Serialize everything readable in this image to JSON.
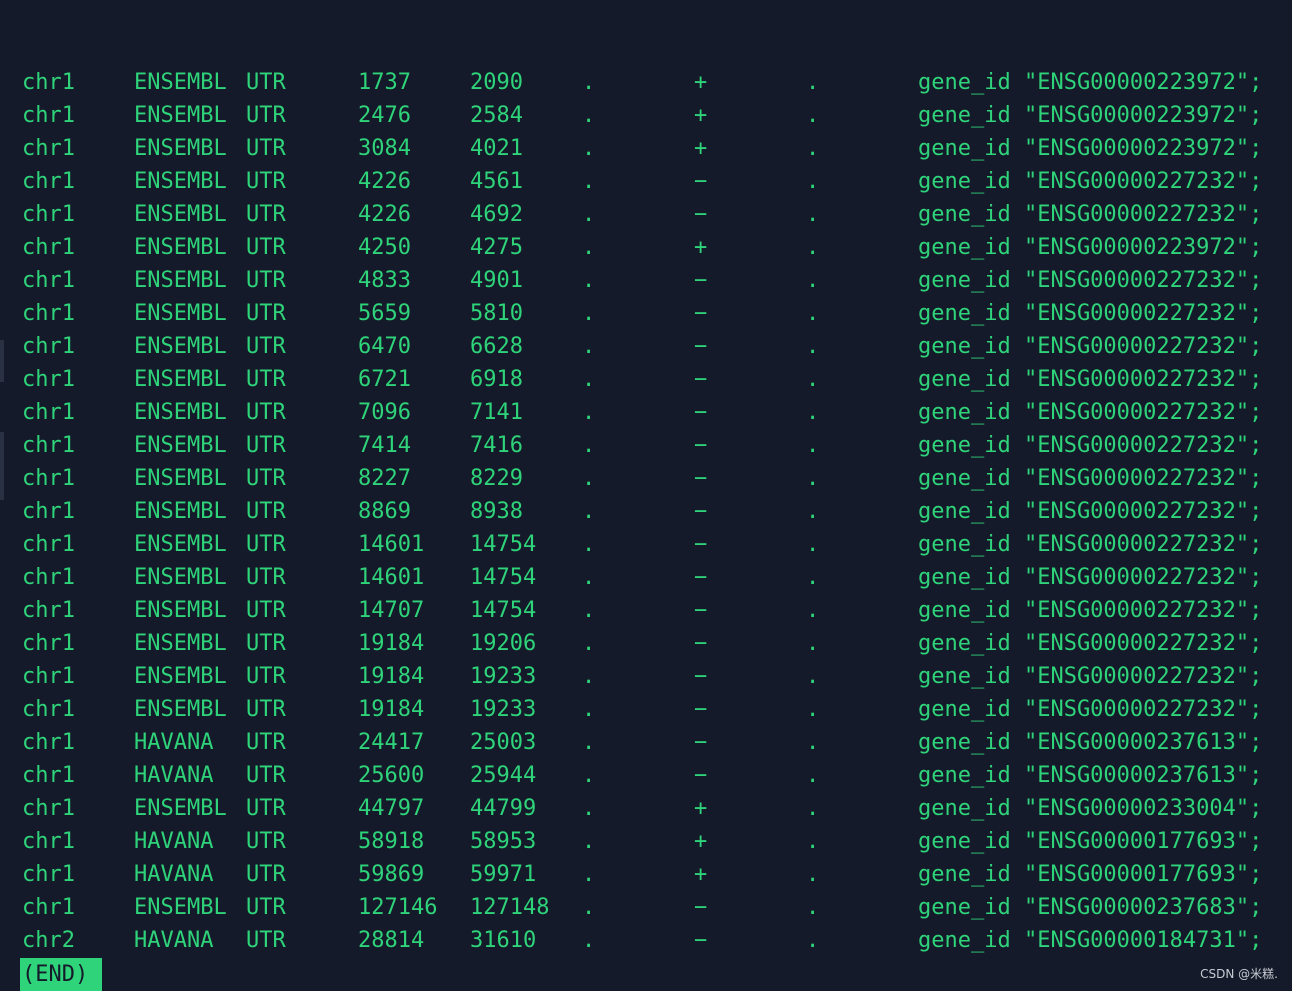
{
  "rows": [
    {
      "seq": "chr1",
      "source": "ENSEMBL",
      "feature": "UTR",
      "start": "1737",
      "end": "2090",
      "score": ".",
      "strand": "+",
      "frame": ".",
      "attr": "gene_id \"ENSG00000223972\";"
    },
    {
      "seq": "chr1",
      "source": "ENSEMBL",
      "feature": "UTR",
      "start": "2476",
      "end": "2584",
      "score": ".",
      "strand": "+",
      "frame": ".",
      "attr": "gene_id \"ENSG00000223972\";"
    },
    {
      "seq": "chr1",
      "source": "ENSEMBL",
      "feature": "UTR",
      "start": "3084",
      "end": "4021",
      "score": ".",
      "strand": "+",
      "frame": ".",
      "attr": "gene_id \"ENSG00000223972\";"
    },
    {
      "seq": "chr1",
      "source": "ENSEMBL",
      "feature": "UTR",
      "start": "4226",
      "end": "4561",
      "score": ".",
      "strand": "−",
      "frame": ".",
      "attr": "gene_id \"ENSG00000227232\";"
    },
    {
      "seq": "chr1",
      "source": "ENSEMBL",
      "feature": "UTR",
      "start": "4226",
      "end": "4692",
      "score": ".",
      "strand": "−",
      "frame": ".",
      "attr": "gene_id \"ENSG00000227232\";"
    },
    {
      "seq": "chr1",
      "source": "ENSEMBL",
      "feature": "UTR",
      "start": "4250",
      "end": "4275",
      "score": ".",
      "strand": "+",
      "frame": ".",
      "attr": "gene_id \"ENSG00000223972\";"
    },
    {
      "seq": "chr1",
      "source": "ENSEMBL",
      "feature": "UTR",
      "start": "4833",
      "end": "4901",
      "score": ".",
      "strand": "−",
      "frame": ".",
      "attr": "gene_id \"ENSG00000227232\";"
    },
    {
      "seq": "chr1",
      "source": "ENSEMBL",
      "feature": "UTR",
      "start": "5659",
      "end": "5810",
      "score": ".",
      "strand": "−",
      "frame": ".",
      "attr": "gene_id \"ENSG00000227232\";"
    },
    {
      "seq": "chr1",
      "source": "ENSEMBL",
      "feature": "UTR",
      "start": "6470",
      "end": "6628",
      "score": ".",
      "strand": "−",
      "frame": ".",
      "attr": "gene_id \"ENSG00000227232\";"
    },
    {
      "seq": "chr1",
      "source": "ENSEMBL",
      "feature": "UTR",
      "start": "6721",
      "end": "6918",
      "score": ".",
      "strand": "−",
      "frame": ".",
      "attr": "gene_id \"ENSG00000227232\";"
    },
    {
      "seq": "chr1",
      "source": "ENSEMBL",
      "feature": "UTR",
      "start": "7096",
      "end": "7141",
      "score": ".",
      "strand": "−",
      "frame": ".",
      "attr": "gene_id \"ENSG00000227232\";"
    },
    {
      "seq": "chr1",
      "source": "ENSEMBL",
      "feature": "UTR",
      "start": "7414",
      "end": "7416",
      "score": ".",
      "strand": "−",
      "frame": ".",
      "attr": "gene_id \"ENSG00000227232\";"
    },
    {
      "seq": "chr1",
      "source": "ENSEMBL",
      "feature": "UTR",
      "start": "8227",
      "end": "8229",
      "score": ".",
      "strand": "−",
      "frame": ".",
      "attr": "gene_id \"ENSG00000227232\";"
    },
    {
      "seq": "chr1",
      "source": "ENSEMBL",
      "feature": "UTR",
      "start": "8869",
      "end": "8938",
      "score": ".",
      "strand": "−",
      "frame": ".",
      "attr": "gene_id \"ENSG00000227232\";"
    },
    {
      "seq": "chr1",
      "source": "ENSEMBL",
      "feature": "UTR",
      "start": "14601",
      "end": "14754",
      "score": ".",
      "strand": "−",
      "frame": ".",
      "attr": "gene_id \"ENSG00000227232\";"
    },
    {
      "seq": "chr1",
      "source": "ENSEMBL",
      "feature": "UTR",
      "start": "14601",
      "end": "14754",
      "score": ".",
      "strand": "−",
      "frame": ".",
      "attr": "gene_id \"ENSG00000227232\";"
    },
    {
      "seq": "chr1",
      "source": "ENSEMBL",
      "feature": "UTR",
      "start": "14707",
      "end": "14754",
      "score": ".",
      "strand": "−",
      "frame": ".",
      "attr": "gene_id \"ENSG00000227232\";"
    },
    {
      "seq": "chr1",
      "source": "ENSEMBL",
      "feature": "UTR",
      "start": "19184",
      "end": "19206",
      "score": ".",
      "strand": "−",
      "frame": ".",
      "attr": "gene_id \"ENSG00000227232\";"
    },
    {
      "seq": "chr1",
      "source": "ENSEMBL",
      "feature": "UTR",
      "start": "19184",
      "end": "19233",
      "score": ".",
      "strand": "−",
      "frame": ".",
      "attr": "gene_id \"ENSG00000227232\";"
    },
    {
      "seq": "chr1",
      "source": "ENSEMBL",
      "feature": "UTR",
      "start": "19184",
      "end": "19233",
      "score": ".",
      "strand": "−",
      "frame": ".",
      "attr": "gene_id \"ENSG00000227232\";"
    },
    {
      "seq": "chr1",
      "source": "HAVANA",
      "feature": "UTR",
      "start": "24417",
      "end": "25003",
      "score": ".",
      "strand": "−",
      "frame": ".",
      "attr": "gene_id \"ENSG00000237613\";"
    },
    {
      "seq": "chr1",
      "source": "HAVANA",
      "feature": "UTR",
      "start": "25600",
      "end": "25944",
      "score": ".",
      "strand": "−",
      "frame": ".",
      "attr": "gene_id \"ENSG00000237613\";"
    },
    {
      "seq": "chr1",
      "source": "ENSEMBL",
      "feature": "UTR",
      "start": "44797",
      "end": "44799",
      "score": ".",
      "strand": "+",
      "frame": ".",
      "attr": "gene_id \"ENSG00000233004\";"
    },
    {
      "seq": "chr1",
      "source": "HAVANA",
      "feature": "UTR",
      "start": "58918",
      "end": "58953",
      "score": ".",
      "strand": "+",
      "frame": ".",
      "attr": "gene_id \"ENSG00000177693\";"
    },
    {
      "seq": "chr1",
      "source": "HAVANA",
      "feature": "UTR",
      "start": "59869",
      "end": "59971",
      "score": ".",
      "strand": "+",
      "frame": ".",
      "attr": "gene_id \"ENSG00000177693\";"
    },
    {
      "seq": "chr1",
      "source": "ENSEMBL",
      "feature": "UTR",
      "start": "127146",
      "end": "127148",
      "score": ".",
      "strand": "−",
      "frame": ".",
      "attr": "gene_id \"ENSG00000237683\";"
    },
    {
      "seq": "chr2",
      "source": "HAVANA",
      "feature": "UTR",
      "start": "28814",
      "end": "31610",
      "score": ".",
      "strand": "−",
      "frame": ".",
      "attr": "gene_id \"ENSG00000184731\";"
    }
  ],
  "pager": {
    "end_label": "(END)"
  },
  "watermark": "CSDN @米糕.",
  "colors": {
    "background": "#141a29",
    "text": "#2fd37a"
  }
}
